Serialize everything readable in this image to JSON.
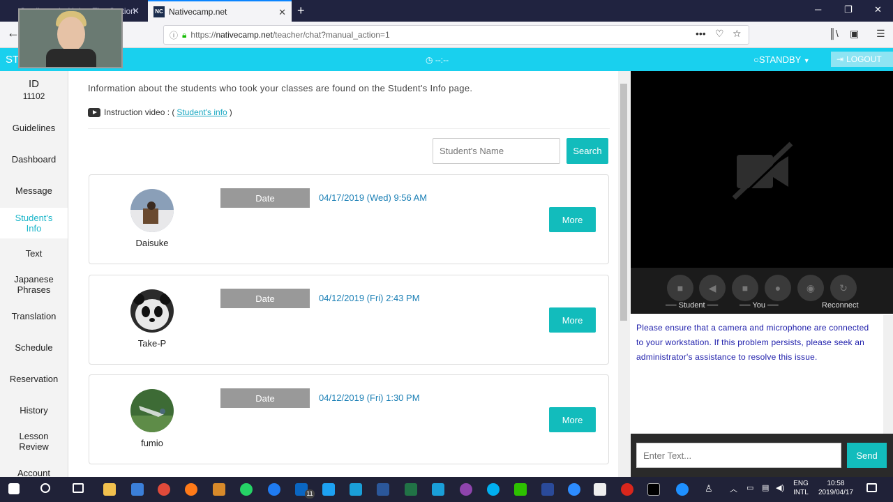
{
  "browser": {
    "inactive_tab_title": "Credit card - Help - The Station",
    "active_tab_title": "Nativecamp.net",
    "favicon_text": "NC",
    "new_tab": "+",
    "url_prefix": "https://",
    "url_host": "nativecamp.net",
    "url_path": "/teacher/chat?manual_action=1"
  },
  "app": {
    "brand": "ST",
    "timer": "--:--",
    "standby": "STANDBY",
    "logout": "LOGOUT",
    "accent": "#19d0ee"
  },
  "sidebar": {
    "id_label": "ID",
    "id_number": "11102",
    "items": [
      {
        "label": "Guidelines"
      },
      {
        "label": "Dashboard"
      },
      {
        "label": "Message"
      },
      {
        "label": "Student's Info"
      },
      {
        "label": "Text"
      },
      {
        "label": "Japanese Phrases"
      },
      {
        "label": "Translation"
      },
      {
        "label": "Schedule"
      },
      {
        "label": "Reservation"
      },
      {
        "label": "History"
      },
      {
        "label": "Lesson Review"
      },
      {
        "label": "Account"
      }
    ]
  },
  "main": {
    "intro": "Information about the students who took your classes are found on the Student's Info page.",
    "instruction_prefix": "Instruction video : (",
    "instruction_link": "Student's info",
    "instruction_suffix": ")",
    "search_placeholder": "Student's Name",
    "search_button": "Search",
    "date_label": "Date",
    "more_label": "More",
    "students": [
      {
        "name": "Daisuke",
        "date": "04/17/2019 (Wed) 9:56 AM"
      },
      {
        "name": "Take-P",
        "date": "04/12/2019 (Fri) 2:43 PM"
      },
      {
        "name": "fumio",
        "date": "04/12/2019 (Fri) 1:30 PM"
      }
    ]
  },
  "call": {
    "label_student": "Student",
    "label_you": "You",
    "label_reconnect": "Reconnect",
    "message": "Please ensure that a camera and microphone are connected to your workstation. If this problem persists, please seek an administrator's assistance to resolve this issue.",
    "chat_placeholder": "Enter Text...",
    "send": "Send"
  },
  "taskbar": {
    "lang_top": "ENG",
    "lang_bottom": "INTL",
    "time": "10:58",
    "date": "2019/04/17",
    "linkedin_badge": "11"
  }
}
